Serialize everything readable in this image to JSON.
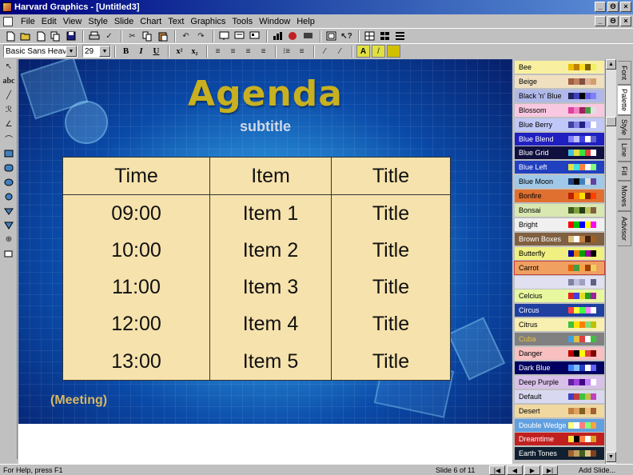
{
  "window": {
    "title": "Harvard Graphics - [Untitled3]",
    "controls": [
      "_",
      "Θ",
      "×"
    ]
  },
  "menubar": {
    "items": [
      "File",
      "Edit",
      "View",
      "Style",
      "Slide",
      "Chart",
      "Text",
      "Graphics",
      "Tools",
      "Window",
      "Help"
    ]
  },
  "toolbar1": {
    "icons": [
      "new-icon",
      "open-icon",
      "new-slide-icon",
      "copy-slide-icon",
      "save-icon",
      "print-icon",
      "spellcheck-icon",
      "cut-icon",
      "copy-icon",
      "paste-icon",
      "undo-icon",
      "redo-icon",
      "slide-view-icon",
      "outline-view-icon",
      "sorter-view-icon",
      "chart-icon",
      "drawing-icon",
      "presentation-icon",
      "frame-icon",
      "context-help-icon",
      "grid-icon",
      "layout-icon",
      "list-icon"
    ]
  },
  "toolbar2": {
    "font_name": "Basic Sans Heavy S",
    "font_size": "29",
    "bold": "B",
    "italic": "I",
    "underline": "U",
    "superscript": "x²",
    "subscript": "x₂"
  },
  "slide": {
    "title": "Agenda",
    "subtitle": "subtitle",
    "footer": "(Meeting)",
    "table": {
      "headers": [
        "Time",
        "Item",
        "Title"
      ],
      "rows": [
        [
          "09:00",
          "Item 1",
          "Title"
        ],
        [
          "10:00",
          "Item 2",
          "Title"
        ],
        [
          "11:00",
          "Item 3",
          "Title"
        ],
        [
          "12:00",
          "Item 4",
          "Title"
        ],
        [
          "13:00",
          "Item 5",
          "Title"
        ]
      ]
    }
  },
  "palette": {
    "items": [
      {
        "name": "Bee",
        "bg": "#f8f0a0",
        "fg": "#000000",
        "colors": [
          "#e8c000",
          "#c08000",
          "#ffe020",
          "#806000",
          "#f0f060"
        ]
      },
      {
        "name": "Beige",
        "bg": "#f0e0c0",
        "fg": "#000000",
        "colors": [
          "#a06040",
          "#c08060",
          "#805040",
          "#e0b090",
          "#d0a070"
        ]
      },
      {
        "name": "Black 'n' Blue",
        "bg": "#b0b8e8",
        "fg": "#000000",
        "colors": [
          "#202060",
          "#4040c0",
          "#000000",
          "#6060e0",
          "#8080ff"
        ]
      },
      {
        "name": "Blossom",
        "bg": "#f8c8e0",
        "fg": "#000000",
        "colors": [
          "#e040a0",
          "#f080c0",
          "#a02060",
          "#40a040",
          "#e0e0e0"
        ]
      },
      {
        "name": "Blue Berry",
        "bg": "#c0c8f8",
        "fg": "#000000",
        "colors": [
          "#4040a0",
          "#8080e0",
          "#202080",
          "#a0a0ff",
          "#ffffff"
        ]
      },
      {
        "name": "Blue Blend",
        "bg": "#2020c0",
        "fg": "#ffffff",
        "colors": [
          "#8080ff",
          "#c0c0ff",
          "#4040e0",
          "#ffffff",
          "#6060d0"
        ]
      },
      {
        "name": "Blue Grid",
        "bg": "#101040",
        "fg": "#ffffff",
        "colors": [
          "#40c0e0",
          "#e0e040",
          "#40e040",
          "#e04040",
          "#ffffff"
        ]
      },
      {
        "name": "Blue Left",
        "bg": "#2040c0",
        "fg": "#ffffff",
        "colors": [
          "#e0e040",
          "#40e0e0",
          "#ff8040",
          "#ffffff",
          "#80ff80"
        ]
      },
      {
        "name": "Blue Moon",
        "bg": "#a0c8e8",
        "fg": "#000000",
        "colors": [
          "#204080",
          "#000000",
          "#4080c0",
          "#e0e0e0",
          "#6040a0"
        ]
      },
      {
        "name": "Bonfire",
        "bg": "#e07030",
        "fg": "#000000",
        "colors": [
          "#c02000",
          "#ff8000",
          "#ffe000",
          "#802000",
          "#ff4000"
        ]
      },
      {
        "name": "Bonsai",
        "bg": "#d8e8b0",
        "fg": "#000000",
        "colors": [
          "#406020",
          "#80a040",
          "#204010",
          "#c0c060",
          "#806040"
        ]
      },
      {
        "name": "Bright",
        "bg": "#f0f0f0",
        "fg": "#000000",
        "colors": [
          "#ff0000",
          "#00c000",
          "#0000ff",
          "#ffff00",
          "#ff00ff"
        ]
      },
      {
        "name": "Brown Boxes",
        "bg": "#806040",
        "fg": "#ffffff",
        "colors": [
          "#e0c080",
          "#ffffff",
          "#c08040",
          "#402010",
          "#a06020"
        ]
      },
      {
        "name": "Butterfly",
        "bg": "#f0f080",
        "fg": "#000000",
        "colors": [
          "#0000a0",
          "#e08000",
          "#00a000",
          "#a000a0",
          "#000000"
        ]
      },
      {
        "name": "Carrot",
        "bg": "#f0a060",
        "fg": "#000000",
        "colors": [
          "#e06000",
          "#40a040",
          "#ffa040",
          "#a04000",
          "#f0d060"
        ]
      },
      {
        "name": "",
        "bg": "#e0e0f0",
        "fg": "#000000",
        "colors": [
          "#8080a0",
          "#c0c0e0",
          "#a0a0c0",
          "#e0e0ff",
          "#606080"
        ]
      },
      {
        "name": "Celcius",
        "bg": "#e8f8a0",
        "fg": "#000000",
        "colors": [
          "#e02020",
          "#4040e0",
          "#e0e020",
          "#20a020",
          "#a020a0"
        ]
      },
      {
        "name": "Circus",
        "bg": "#2040a0",
        "fg": "#ffffff",
        "colors": [
          "#ff4040",
          "#ffff40",
          "#40ff40",
          "#ff80ff",
          "#ffffff"
        ]
      },
      {
        "name": "Citrus",
        "bg": "#f8f0b0",
        "fg": "#000000",
        "colors": [
          "#40c040",
          "#ffe000",
          "#ff8000",
          "#80e080",
          "#c0c000"
        ]
      },
      {
        "name": "Cuba",
        "bg": "#808080",
        "fg": "#e8c040",
        "colors": [
          "#40a0e0",
          "#e0c040",
          "#e04040",
          "#ffffff",
          "#40c040"
        ]
      },
      {
        "name": "Danger",
        "bg": "#f8c0c0",
        "fg": "#000000",
        "colors": [
          "#c00000",
          "#000000",
          "#ffff00",
          "#e04040",
          "#800000"
        ]
      },
      {
        "name": "Dark Blue",
        "bg": "#000060",
        "fg": "#ffffff",
        "colors": [
          "#4080ff",
          "#80c0ff",
          "#2040c0",
          "#ffffff",
          "#6060ff"
        ]
      },
      {
        "name": "Deep Purple",
        "bg": "#d8c0e8",
        "fg": "#000000",
        "colors": [
          "#6020a0",
          "#a040e0",
          "#400080",
          "#c080ff",
          "#ffffff"
        ]
      },
      {
        "name": "Default",
        "bg": "#d8d8f0",
        "fg": "#000000",
        "colors": [
          "#4040c0",
          "#c04040",
          "#40c040",
          "#c0c040",
          "#c040c0"
        ]
      },
      {
        "name": "Desert",
        "bg": "#f0d8a0",
        "fg": "#000000",
        "colors": [
          "#c08040",
          "#e0a060",
          "#806020",
          "#f0c080",
          "#a06030"
        ]
      },
      {
        "name": "Double Wedge",
        "bg": "#60a0e0",
        "fg": "#ffffff",
        "colors": [
          "#ffff80",
          "#ffffff",
          "#ff8080",
          "#80ff80",
          "#ffa040"
        ]
      },
      {
        "name": "Dreamtime",
        "bg": "#c02020",
        "fg": "#ffffff",
        "colors": [
          "#ffe040",
          "#000000",
          "#ff8040",
          "#ffffff",
          "#e0a020"
        ]
      },
      {
        "name": "Earth Tones",
        "bg": "#102030",
        "fg": "#ffffff",
        "colors": [
          "#a06030",
          "#c0a060",
          "#406020",
          "#e0c080",
          "#804020"
        ]
      }
    ]
  },
  "sidetabs": [
    "Font",
    "Palette",
    "Style",
    "Line",
    "Fill",
    "Moves",
    "Advisor"
  ],
  "statusbar": {
    "help": "For Help, press F1",
    "slide_indicator": "Slide 6 of 11",
    "add_slide": "Add Slide..."
  }
}
